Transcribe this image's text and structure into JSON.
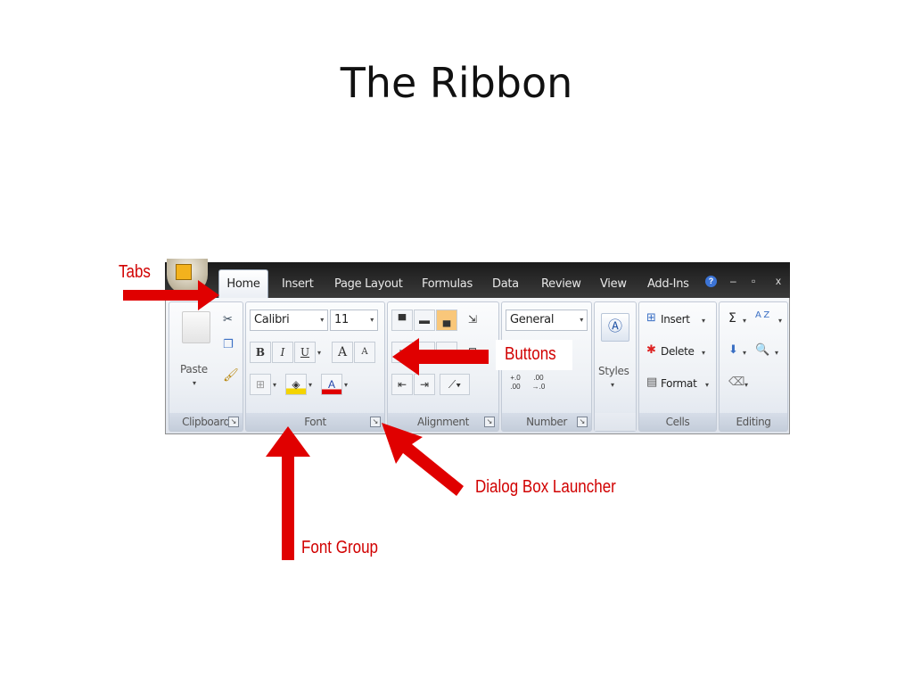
{
  "slide": {
    "title": "The Ribbon"
  },
  "ribbon": {
    "tabs": [
      "Home",
      "Insert",
      "Page Layout",
      "Formulas",
      "Data",
      "Review",
      "View",
      "Add-Ins"
    ],
    "window_controls": {
      "help": "?",
      "minimize": "–",
      "restore": "▫",
      "close": "x"
    },
    "groups": {
      "clipboard": {
        "label": "Clipboard",
        "paste_label": "Paste"
      },
      "font": {
        "label": "Font",
        "font_name": "Calibri",
        "font_size": "11",
        "bold": "B",
        "italic": "I",
        "underline": "U",
        "grow": "A",
        "shrink": "A",
        "font_color": "A"
      },
      "alignment": {
        "label": "Alignment"
      },
      "number": {
        "label": "Number",
        "format": "General",
        "increase_decimal": ".0\n.00",
        "decrease_decimal": ".00\n→.0"
      },
      "styles": {
        "label": "Styles"
      },
      "cells": {
        "label": "Cells",
        "insert": "Insert",
        "delete": "Delete",
        "format": "Format"
      },
      "editing": {
        "label": "Editing",
        "sum": "Σ",
        "sort": "A Z"
      }
    }
  },
  "annotations": {
    "tabs": "Tabs",
    "buttons": "Buttons",
    "dialog_launcher": "Dialog Box Launcher",
    "font_group": "Font Group"
  },
  "colors": {
    "arrow": "#e00000",
    "tab_strip": "#2a2a2a",
    "ribbon_bg": "#e8ecf2"
  }
}
